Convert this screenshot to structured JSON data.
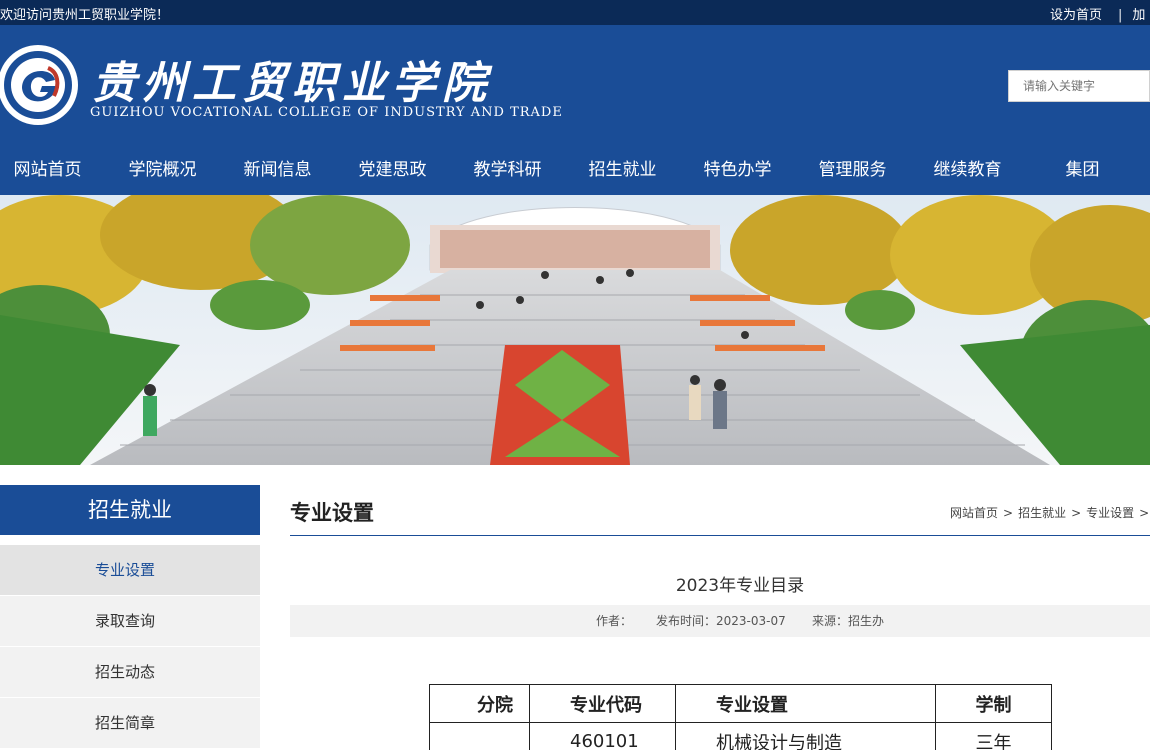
{
  "topbar": {
    "welcome": "欢迎访问贵州工贸职业学院！",
    "set_home": "设为首页",
    "separator": "|",
    "add_fav": "加"
  },
  "header": {
    "cn_name": "贵州工贸职业学院",
    "en_name": "GUIZHOU VOCATIONAL COLLEGE OF INDUSTRY AND TRADE",
    "search_placeholder": "请输入关键字",
    "brand_color": "#1a4d97"
  },
  "nav": {
    "items": [
      "网站首页",
      "学院概况",
      "新闻信息",
      "党建思政",
      "教学科研",
      "招生就业",
      "特色办学",
      "管理服务",
      "继续教育",
      "集团"
    ]
  },
  "sidebar": {
    "title": "招生就业",
    "items": [
      "专业设置",
      "录取查询",
      "招生动态",
      "招生简章"
    ],
    "active_index": 0
  },
  "content": {
    "section_title": "专业设置",
    "breadcrumb": [
      "网站首页",
      "招生就业",
      "专业设置"
    ],
    "breadcrumb_sep": ">",
    "article_title": "2023年专业目录",
    "meta": {
      "author": "作者：",
      "publish_time": "发布时间：2023-03-07",
      "source": "来源：招生办"
    },
    "table": {
      "headers": [
        "分院",
        "专业代码",
        "专业设置",
        "学制"
      ],
      "rows": [
        [
          "",
          "460101",
          "机械设计与制造",
          "三年"
        ]
      ]
    }
  }
}
